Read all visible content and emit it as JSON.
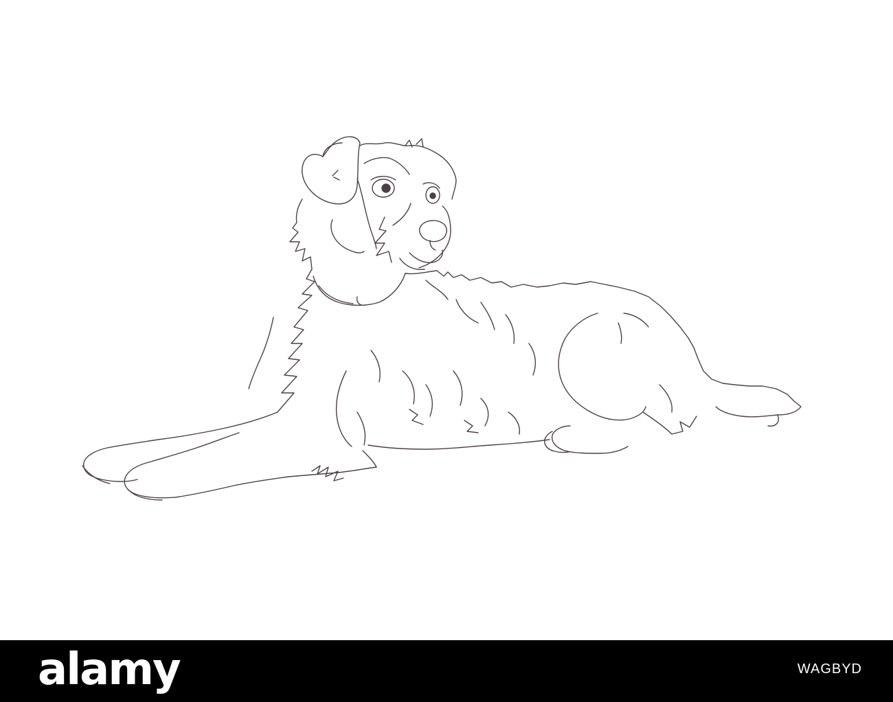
{
  "illustration": {
    "subject": "dog-lying-down-line-drawing",
    "line_color": "#4a4047",
    "background_color": "#ffffff"
  },
  "footer": {
    "brand_logo_text": "alamy",
    "image_id": "WAGBYD",
    "background_color": "#000000",
    "text_color": "#ffffff"
  }
}
